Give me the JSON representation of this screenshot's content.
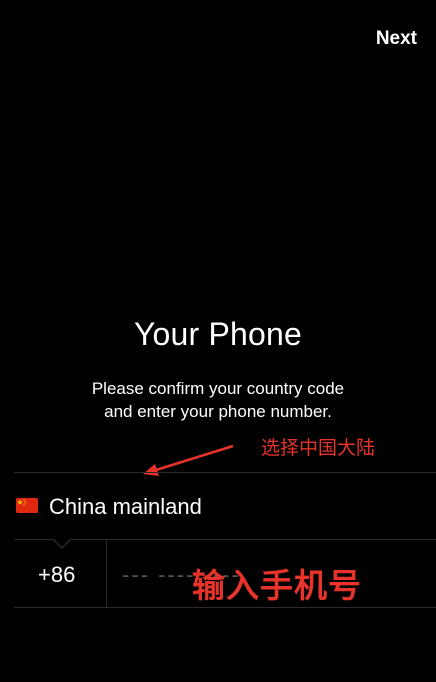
{
  "header": {
    "next_label": "Next"
  },
  "main": {
    "title": "Your Phone",
    "subtitle_line1": "Please confirm your country code",
    "subtitle_line2": "and enter your phone number."
  },
  "country": {
    "flag_icon": "china-flag-icon",
    "name": "China mainland"
  },
  "phone": {
    "code": "+86",
    "placeholder": "--- ---- ----",
    "value": ""
  },
  "annotations": {
    "select_country": "选择中国大陆",
    "enter_phone": "输入手机号",
    "color": "#e8332a"
  },
  "colors": {
    "background": "#000000",
    "text": "#ffffff",
    "divider": "#2a2a2a",
    "annotation": "#e8332a"
  }
}
